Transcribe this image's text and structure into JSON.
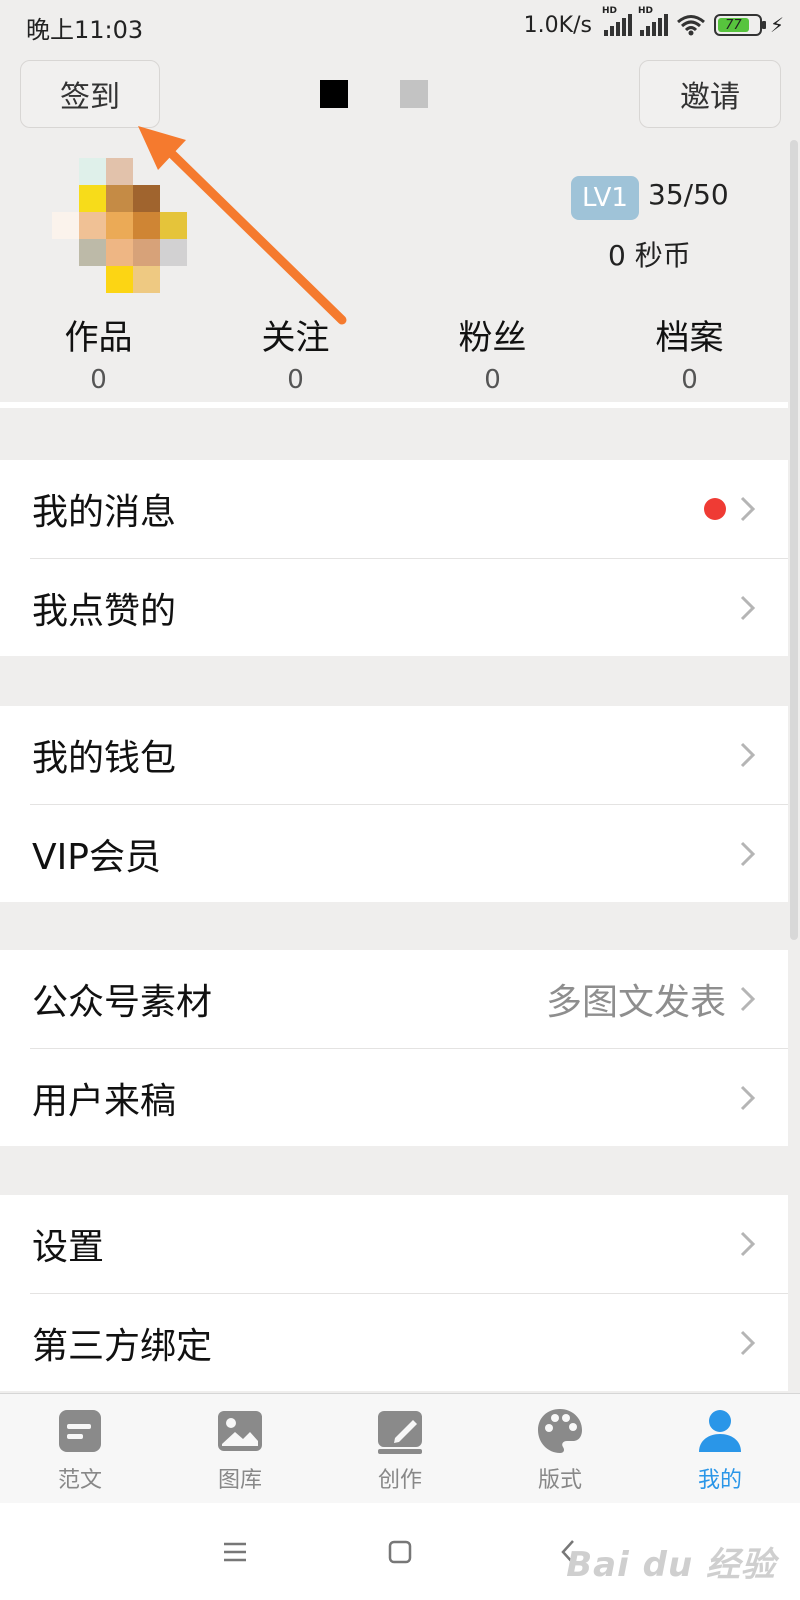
{
  "status_bar": {
    "time": "晚上11:03",
    "net_speed": "1.0K/s",
    "battery_level": "77",
    "battery_percent": 77,
    "signal_tag": "HD"
  },
  "header": {
    "checkin_label": "签到",
    "invite_label": "邀请"
  },
  "profile": {
    "level": "LV1",
    "level_progress": "35/50",
    "coins": "0 秒币"
  },
  "stats": [
    {
      "label": "作品",
      "value": "0"
    },
    {
      "label": "关注",
      "value": "0"
    },
    {
      "label": "粉丝",
      "value": "0"
    },
    {
      "label": "档案",
      "value": "0"
    }
  ],
  "menu": {
    "messages": "我的消息",
    "liked": "我点赞的",
    "wallet": "我的钱包",
    "vip": "VIP会员",
    "wechat_material": "公众号素材",
    "wechat_material_value": "多图文发表",
    "submissions": "用户来稿",
    "settings": "设置",
    "third_party": "第三方绑定"
  },
  "tabs": [
    {
      "label": "范文",
      "icon": "article-icon"
    },
    {
      "label": "图库",
      "icon": "gallery-icon"
    },
    {
      "label": "创作",
      "icon": "create-icon"
    },
    {
      "label": "版式",
      "icon": "palette-icon"
    },
    {
      "label": "我的",
      "icon": "user-icon"
    }
  ],
  "watermark": "Bai du 经验",
  "colors": {
    "accent_blue": "#2a96e8",
    "arrow_orange": "#f57a2e",
    "level_badge": "#9fc3d8",
    "notification_red": "#ef3b34"
  }
}
